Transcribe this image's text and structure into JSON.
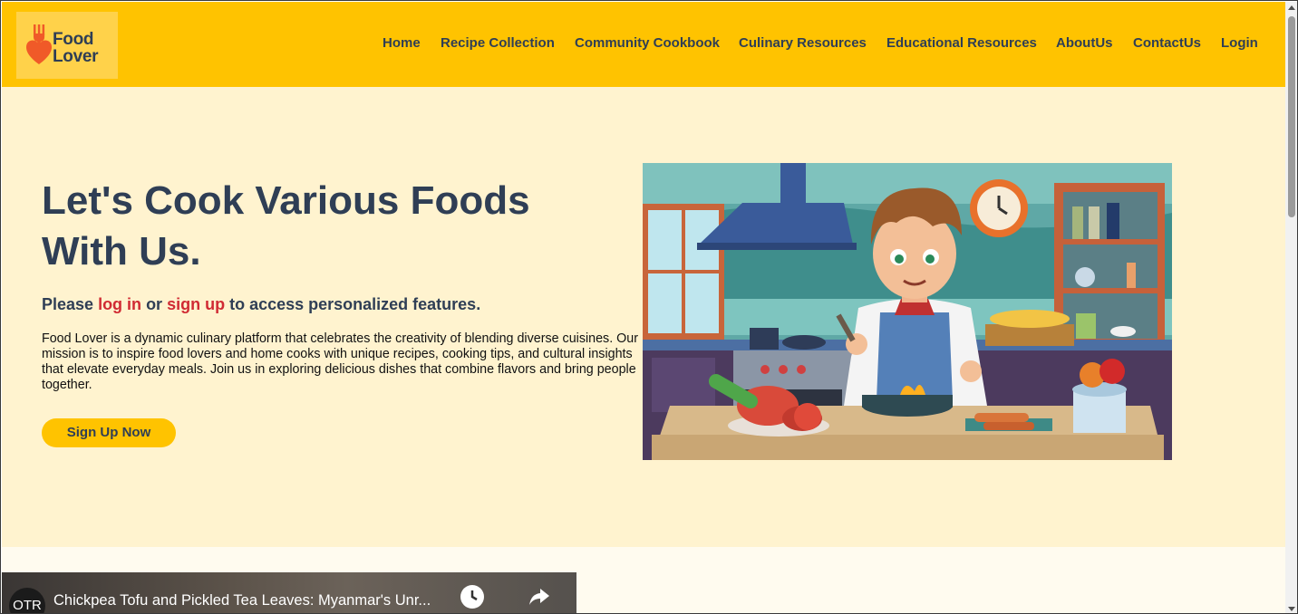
{
  "brand": {
    "name_line1": "Food",
    "name_line2": "Lover",
    "logo_icon": "fork-heart-icon"
  },
  "nav": {
    "items": [
      "Home",
      "Recipe Collection",
      "Community Cookbook",
      "Culinary Resources",
      "Educational Resources",
      "AboutUs",
      "ContactUs",
      "Login"
    ]
  },
  "hero": {
    "title": "Let's Cook Various Foods With Us.",
    "prompt_start": "Please ",
    "prompt_login": "log in",
    "prompt_or": " or ",
    "prompt_signup": "sign up",
    "prompt_end": " to access personalized features.",
    "description": "Food Lover is a dynamic culinary platform that celebrates the creativity of blending diverse cuisines. Our mission is to inspire food lovers and home cooks with unique recipes, cooking tips, and cultural insights that elevate everyday meals. Join us in exploring delicious dishes that combine flavors and bring people together.",
    "cta_label": "Sign Up Now",
    "illustration": "chef-cooking-illustration"
  },
  "video": {
    "channel": "OTR",
    "title": "Chickpea Tofu and Pickled Tea Leaves: Myanmar's Unr...",
    "icons": [
      "watch-later-icon",
      "share-icon"
    ]
  },
  "colors": {
    "header": "#ffc300",
    "hero_bg": "#fff3cf",
    "text_dark": "#2f3e55",
    "accent_red": "#d02a33"
  }
}
